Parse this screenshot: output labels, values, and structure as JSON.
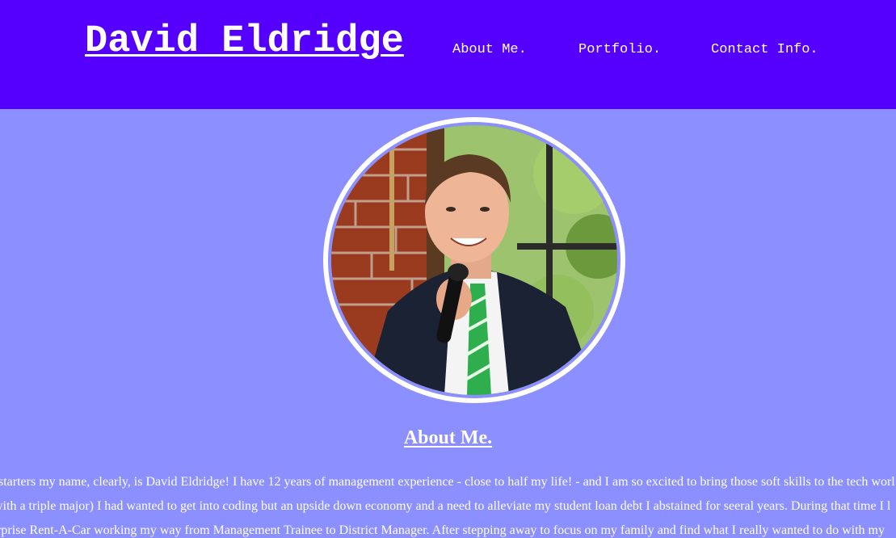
{
  "header": {
    "brand": "David Eldridge",
    "nav": [
      {
        "label": "About Me."
      },
      {
        "label": "Portfolio."
      },
      {
        "label": "Contact Info."
      }
    ],
    "background_color": "#5500ff"
  },
  "page": {
    "background_color": "#8b8fff"
  },
  "profile": {
    "photo_alt": "David Eldridge speaking into a microphone",
    "ring_color": "#ffffff"
  },
  "about": {
    "heading": "About Me.",
    "lines": [
      "starters my name, clearly, is David Eldridge! I have 12 years of management experience - close to half my life! - and I am so excited to bring those soft skills to the tech worl",
      "with a triple major) I had wanted to get into coding but an upside down economy and a need to alleviate my student loan debt I abstained for seeral years. During that time I l",
      "erprise Rent-A-Car working my way from Management Trainee to District Manager. After stepping away to focus on my family and find what I really wanted to do with my"
    ]
  }
}
